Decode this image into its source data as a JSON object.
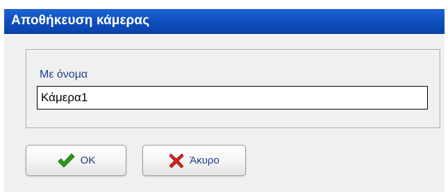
{
  "window": {
    "title": "Αποθήκευση κάμερας"
  },
  "form": {
    "name_label": "Με όνομα",
    "name_value": "Κάμερα1"
  },
  "buttons": {
    "ok": {
      "label": "OK",
      "icon": "check-icon"
    },
    "cancel": {
      "label": "Άκυρο",
      "icon": "x-icon"
    }
  },
  "colors": {
    "titlebar": "#0f4fbf",
    "label_text": "#1e3f8c",
    "ok_icon": "#2f9a1e",
    "cancel_icon": "#d4221a"
  }
}
